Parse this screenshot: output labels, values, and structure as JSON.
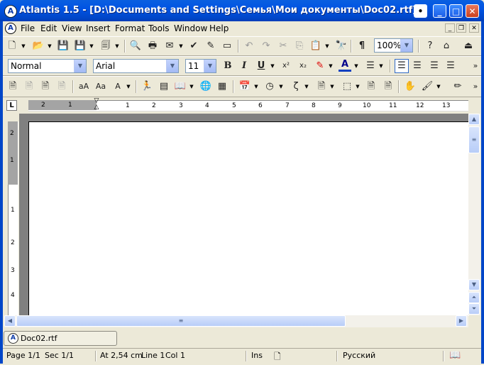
{
  "window": {
    "title": "Atlantis 1.5 - [D:\\Documents and Settings\\Семья\\Мои документы\\Doc02.rtf]"
  },
  "menu": [
    "File",
    "Edit",
    "View",
    "Insert",
    "Format",
    "Tools",
    "Window",
    "Help"
  ],
  "format_bar": {
    "style": "Normal",
    "font": "Arial",
    "size": "11"
  },
  "standard_bar": {
    "zoom": "100%"
  },
  "ruler": {
    "tab_selector": "L",
    "left_numbers": [
      "2",
      "1"
    ],
    "numbers": [
      "1",
      "2",
      "3",
      "4",
      "5",
      "6",
      "7",
      "8",
      "9",
      "10",
      "11",
      "12",
      "13"
    ]
  },
  "vruler": {
    "numbers": [
      "2",
      "1",
      "1",
      "2",
      "3",
      "4"
    ]
  },
  "doc_tab": {
    "label": "Doc02.rtf"
  },
  "status": {
    "page": "Page 1/1",
    "sec": "Sec 1/1",
    "at": "At 2,54 cm",
    "line": "Line 1",
    "col": "Col 1",
    "ins": "Ins",
    "lang": "Русский"
  }
}
